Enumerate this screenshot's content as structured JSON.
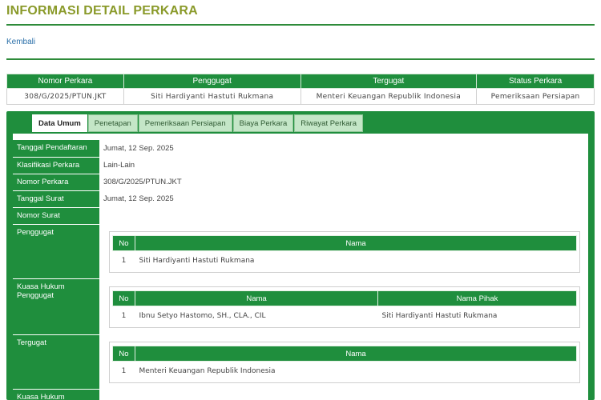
{
  "page_title": "INFORMASI DETAIL PERKARA",
  "back_link": "Kembali",
  "summary": {
    "headers": [
      "Nomor Perkara",
      "Penggugat",
      "Tergugat",
      "Status Perkara"
    ],
    "row": [
      "308/G/2025/PTUN.JKT",
      "Siti Hardiyanti Hastuti Rukmana",
      "Menteri Keuangan Republik Indonesia",
      "Pemeriksaan Persiapan"
    ]
  },
  "tabs": [
    {
      "label": "Data Umum",
      "active": true
    },
    {
      "label": "Penetapan",
      "active": false
    },
    {
      "label": "Pemeriksaan Persiapan",
      "active": false
    },
    {
      "label": "Biaya Perkara",
      "active": false
    },
    {
      "label": "Riwayat Perkara",
      "active": false
    }
  ],
  "details": {
    "tanggal_pendaftaran": {
      "label": "Tanggal Pendaftaran",
      "value": "Jumat, 12 Sep. 2025"
    },
    "klasifikasi_perkara": {
      "label": "Klasifikasi Perkara",
      "value": "Lain-Lain"
    },
    "nomor_perkara": {
      "label": "Nomor Perkara",
      "value": "308/G/2025/PTUN.JKT"
    },
    "tanggal_surat": {
      "label": "Tanggal Surat",
      "value": "Jumat, 12 Sep. 2025"
    },
    "nomor_surat": {
      "label": "Nomor Surat",
      "value": ""
    },
    "penggugat": {
      "label": "Penggugat",
      "headers": [
        "No",
        "Nama"
      ],
      "rows": [
        [
          "1",
          "Siti Hardiyanti Hastuti Rukmana"
        ]
      ]
    },
    "kuasa_hukum_penggugat": {
      "label": "Kuasa Hukum Penggugat",
      "headers": [
        "No",
        "Nama",
        "Nama Pihak"
      ],
      "rows": [
        [
          "1",
          "Ibnu Setyo Hastomo, SH., CLA., CIL",
          "Siti Hardiyanti Hastuti Rukmana"
        ]
      ]
    },
    "tergugat": {
      "label": "Tergugat",
      "headers": [
        "No",
        "Nama"
      ],
      "rows": [
        [
          "1",
          "Menteri Keuangan Republik Indonesia"
        ]
      ]
    },
    "kuasa_hukum_tergugat": {
      "label": "Kuasa Hukum"
    }
  }
}
